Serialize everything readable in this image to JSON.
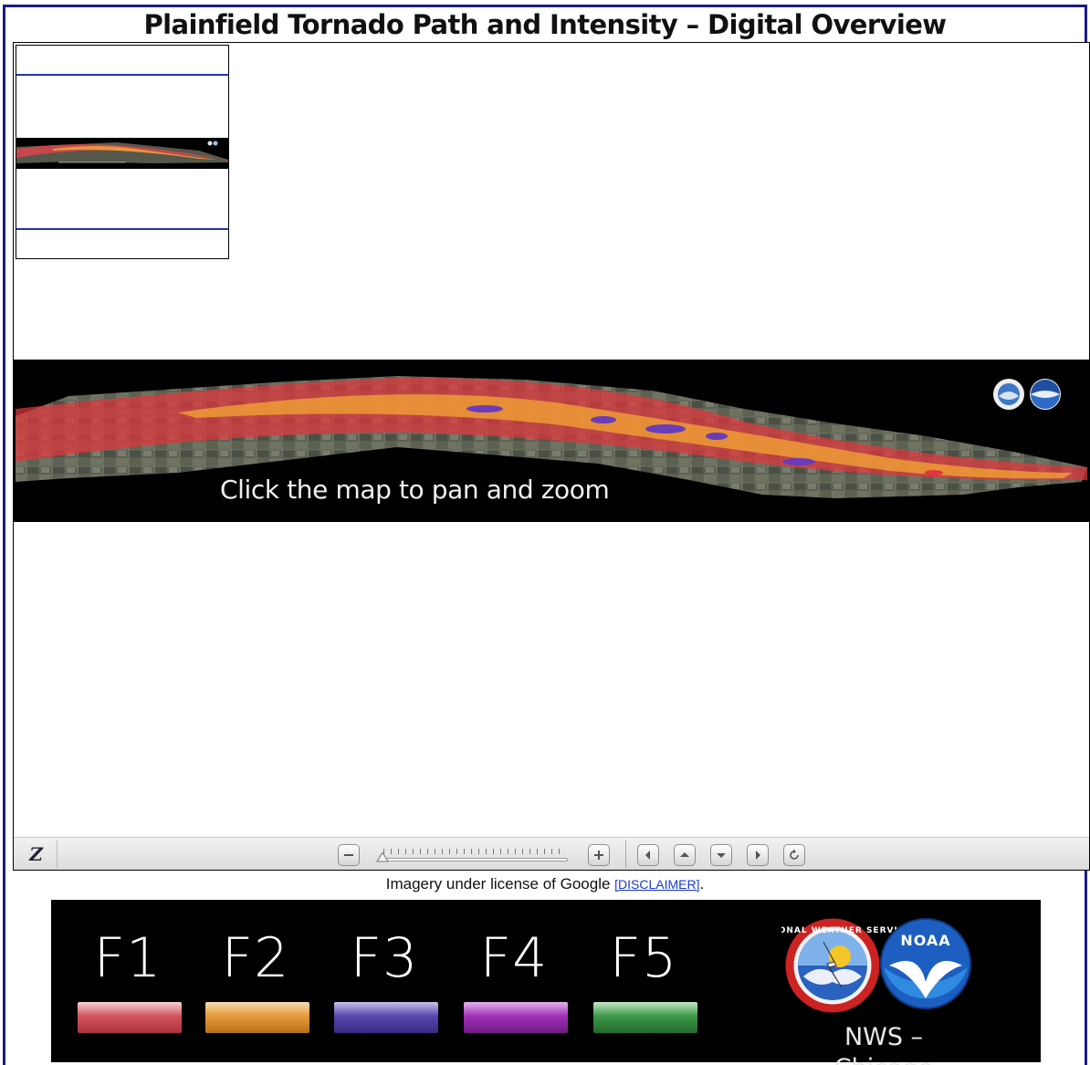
{
  "page": {
    "title": "Plainfield Tornado Path and Intensity – Digital Overview"
  },
  "viewer": {
    "map_caption": "Click the map to pan and zoom",
    "toolbar": {
      "logo_letter": "Z",
      "zoom_out_icon": "minus-icon",
      "zoom_in_icon": "plus-icon",
      "pan_left_icon": "arrow-left-icon",
      "pan_up_icon": "arrow-up-icon",
      "pan_down_icon": "arrow-down-icon",
      "pan_right_icon": "arrow-right-icon",
      "reset_icon": "reset-icon",
      "zoom_level": 0
    }
  },
  "credit": {
    "text": "Imagery under license of Google ",
    "link_label": "[DISCLAIMER]",
    "trailing": "."
  },
  "legend": {
    "items": [
      {
        "label": "F1",
        "color": "#d4545e"
      },
      {
        "label": "F2",
        "color": "#e69a3a"
      },
      {
        "label": "F3",
        "color": "#5648b0"
      },
      {
        "label": "F4",
        "color": "#a030b8"
      },
      {
        "label": "F5",
        "color": "#3e9a48"
      }
    ],
    "agency_label": "NWS – Chicago",
    "noaa_text": "NOAA",
    "nws_ring_text": "NATIONAL WEATHER SERVICE"
  },
  "colors": {
    "frame_border": "#1b1b8a",
    "map_background": "#000000",
    "legend_background": "#000000",
    "link": "#1a3ad6"
  }
}
